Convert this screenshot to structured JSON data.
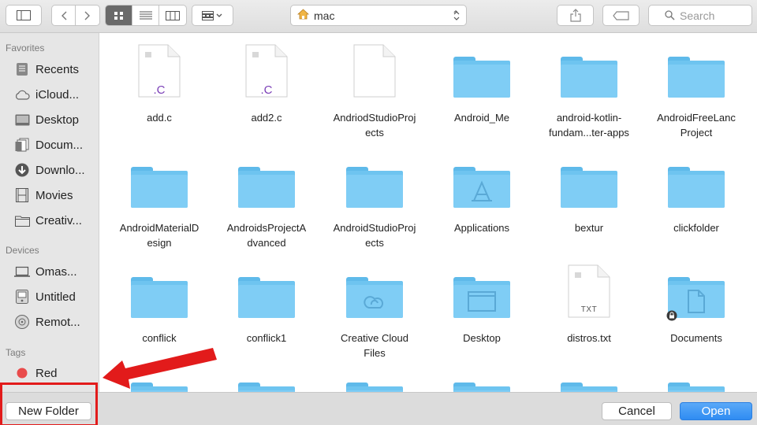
{
  "toolbar": {
    "path_label": "mac",
    "search_placeholder": "Search",
    "icons": [
      "sidebar-toggle-icon",
      "back-icon",
      "forward-icon",
      "icon-view-icon",
      "list-view-icon",
      "column-view-icon",
      "arrange-icon",
      "share-icon",
      "tag-icon",
      "search-icon",
      "home-icon"
    ]
  },
  "sidebar": {
    "favorites_header": "Favorites",
    "favorites": [
      {
        "label": "Recents",
        "icon": "recents-icon"
      },
      {
        "label": "iCloud...",
        "icon": "cloud-icon"
      },
      {
        "label": "Desktop",
        "icon": "desktop-icon"
      },
      {
        "label": "Docum...",
        "icon": "documents-icon"
      },
      {
        "label": "Downlo...",
        "icon": "downloads-icon"
      },
      {
        "label": "Movies",
        "icon": "movies-icon"
      },
      {
        "label": "Creativ...",
        "icon": "folder-icon"
      }
    ],
    "devices_header": "Devices",
    "devices": [
      {
        "label": "Omas...",
        "icon": "laptop-icon"
      },
      {
        "label": "Untitled",
        "icon": "disk-icon"
      },
      {
        "label": "Remot...",
        "icon": "remote-disc-icon"
      }
    ],
    "tags_header": "Tags",
    "tags": [
      {
        "label": "Red",
        "color": "#e94b4b"
      }
    ]
  },
  "files": [
    {
      "label": "add.c",
      "kind": "c-file",
      "ext": ".C"
    },
    {
      "label": "add2.c",
      "kind": "c-file",
      "ext": ".C"
    },
    {
      "label": "AndriodStudioProj\nects",
      "kind": "blank-file"
    },
    {
      "label": "Android_Me",
      "kind": "folder"
    },
    {
      "label": "android-kotlin-\nfundam...ter-apps",
      "kind": "folder"
    },
    {
      "label": "AndroidFreeLanc\nProject",
      "kind": "folder"
    },
    {
      "label": "AndroidMaterialD\nesign",
      "kind": "folder"
    },
    {
      "label": "AndroidsProjectA\ndvanced",
      "kind": "folder"
    },
    {
      "label": "AndroidStudioProj\nects",
      "kind": "folder"
    },
    {
      "label": "Applications",
      "kind": "apps-folder"
    },
    {
      "label": "bextur",
      "kind": "folder"
    },
    {
      "label": "clickfolder",
      "kind": "folder"
    },
    {
      "label": "conflick",
      "kind": "folder"
    },
    {
      "label": "conflick1",
      "kind": "folder"
    },
    {
      "label": "Creative Cloud\nFiles",
      "kind": "cc-folder"
    },
    {
      "label": "Desktop",
      "kind": "desktop-folder"
    },
    {
      "label": "distros.txt",
      "kind": "txt-file",
      "ext": "TXT"
    },
    {
      "label": "Documents",
      "kind": "documents-folder"
    }
  ],
  "footer": {
    "new_folder": "New Folder",
    "cancel": "Cancel",
    "open": "Open"
  },
  "colors": {
    "accent": "#2f8cf2",
    "folder": "#7fcdf5",
    "annotation": "#e21b1b"
  }
}
